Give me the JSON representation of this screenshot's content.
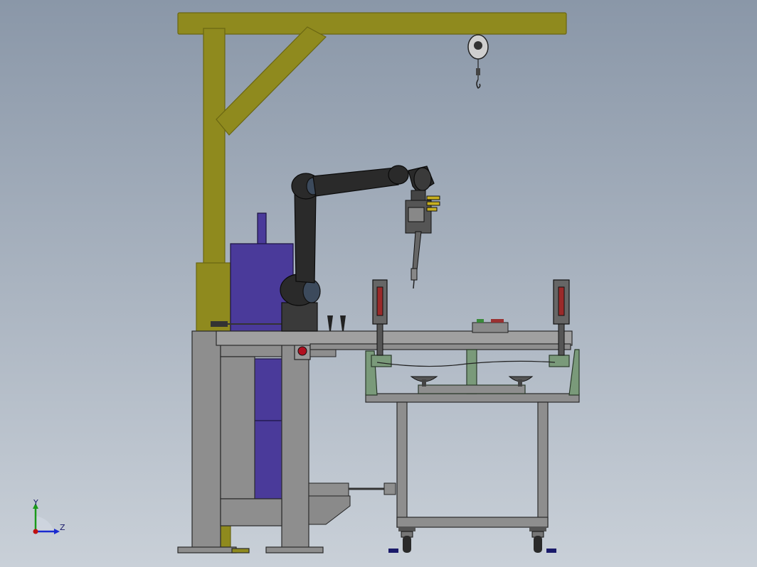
{
  "viewport": {
    "background_top": "#8a97a8",
    "background_bottom": "#c9d0d8"
  },
  "triad": {
    "y_label": "Y",
    "z_label": "Z",
    "y_color": "#1a9a1a",
    "z_color": "#1a2ad0",
    "origin_color": "#c01010"
  },
  "colors": {
    "crane": "#8f8a1e",
    "crane_dark": "#6a6612",
    "frame": "#8e8e8e",
    "frame_dark": "#5e5e5e",
    "cabinet": "#4a3a9a",
    "robot": "#2a2a2a",
    "fixture_green": "#7a9a7a",
    "table_top": "#a0a0a0"
  }
}
